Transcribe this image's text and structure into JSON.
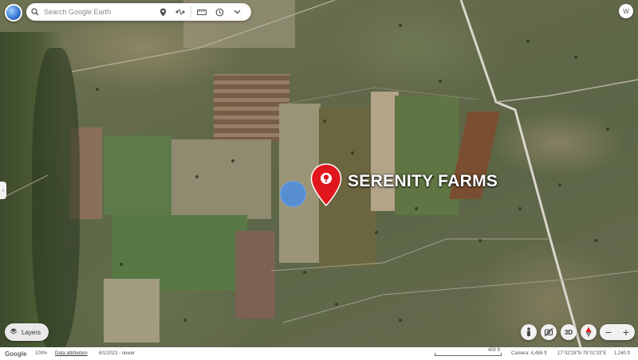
{
  "search": {
    "placeholder": "Search Google Earth"
  },
  "account": {
    "avatar_initial": "W"
  },
  "side_tab": {
    "glyph": "›"
  },
  "place": {
    "label": "SERENITY FARMS",
    "pin_color": "#e0161c",
    "dot_color": "#3f8cf0"
  },
  "layers": {
    "label": "Layers"
  },
  "controls": {
    "three_d_label": "3D",
    "zoom_out_label": "−",
    "zoom_in_label": "+"
  },
  "status_bar": {
    "google_label": "Google",
    "zoom_percent": "100%",
    "attribution_label": "Data attribution",
    "imagery_date": "6/1/2023 - newer",
    "scale_label": "400 ft",
    "camera": "Camera: 4,486 ft",
    "coordinates": "17°32'28\"N 79°01'33\"E",
    "elevation": "1,240 ft"
  },
  "icons": {
    "search": "search-icon",
    "pin": "location-pin-icon",
    "route": "route-icon",
    "measure": "ruler-icon",
    "history": "history-icon",
    "expand": "chevron-down-icon",
    "layers": "layers-icon",
    "pegman": "pegman-icon",
    "no_photo": "hide-photos-icon",
    "compass": "compass-icon"
  },
  "colors": {
    "accent": "#1a73e8",
    "marker": "#e0161c"
  }
}
